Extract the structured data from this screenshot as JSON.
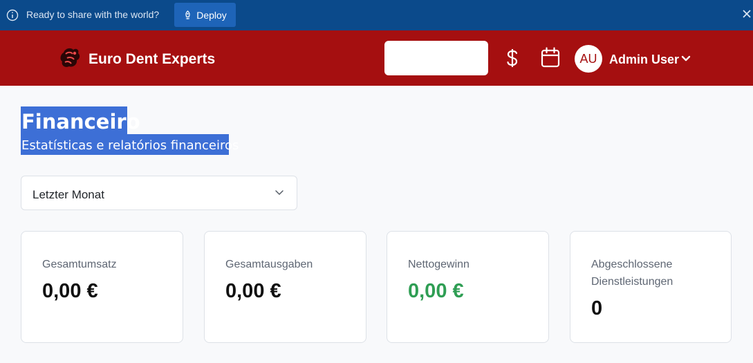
{
  "deploy_bar": {
    "message": "Ready to share with the world?",
    "button_label": "Deploy"
  },
  "header": {
    "brand": "Euro Dent Experts",
    "search_value": "",
    "avatar_initials": "AU",
    "user_name": "Admin User"
  },
  "page": {
    "title": "Financeiro",
    "subtitle": "Estatísticas e relatórios financeiros"
  },
  "period_select": {
    "selected": "Letzter Monat"
  },
  "cards": [
    {
      "label": "Gesamtumsatz",
      "value": "0,00 €"
    },
    {
      "label": "Gesamtausgaben",
      "value": "0,00 €"
    },
    {
      "label": "Nettogewinn",
      "value": "0,00 €"
    },
    {
      "label": "Abgeschlossene Dienstleistungen",
      "value": "0"
    }
  ],
  "colors": {
    "deploy_bar": "#0b4a8b",
    "header": "#a50f10",
    "highlight": "#3d6fd6",
    "profit_green": "#2f9e54"
  }
}
